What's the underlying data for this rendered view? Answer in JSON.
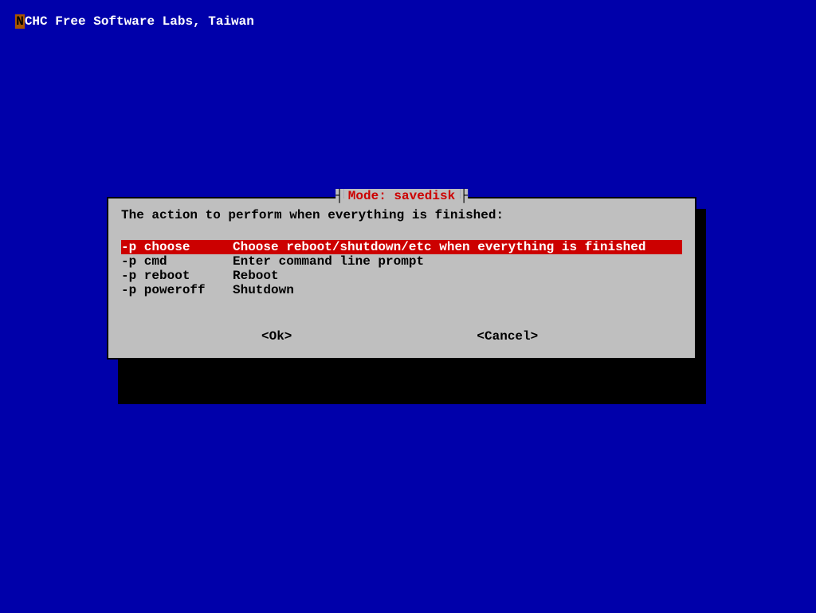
{
  "header": {
    "first_char": "N",
    "rest": "CHC Free Software Labs, Taiwan"
  },
  "dialog": {
    "title": "Mode: savedisk",
    "prompt": "The action to perform when everything is finished:",
    "items": [
      {
        "key": "-p choose",
        "desc": "Choose reboot/shutdown/etc when everything is finished",
        "selected": true
      },
      {
        "key": "-p cmd",
        "desc": "Enter command line prompt",
        "selected": false
      },
      {
        "key": "-p reboot",
        "desc": "Reboot",
        "selected": false
      },
      {
        "key": "-p poweroff",
        "desc": "Shutdown",
        "selected": false
      }
    ],
    "ok_label": "<Ok>",
    "cancel_label": "<Cancel>"
  }
}
